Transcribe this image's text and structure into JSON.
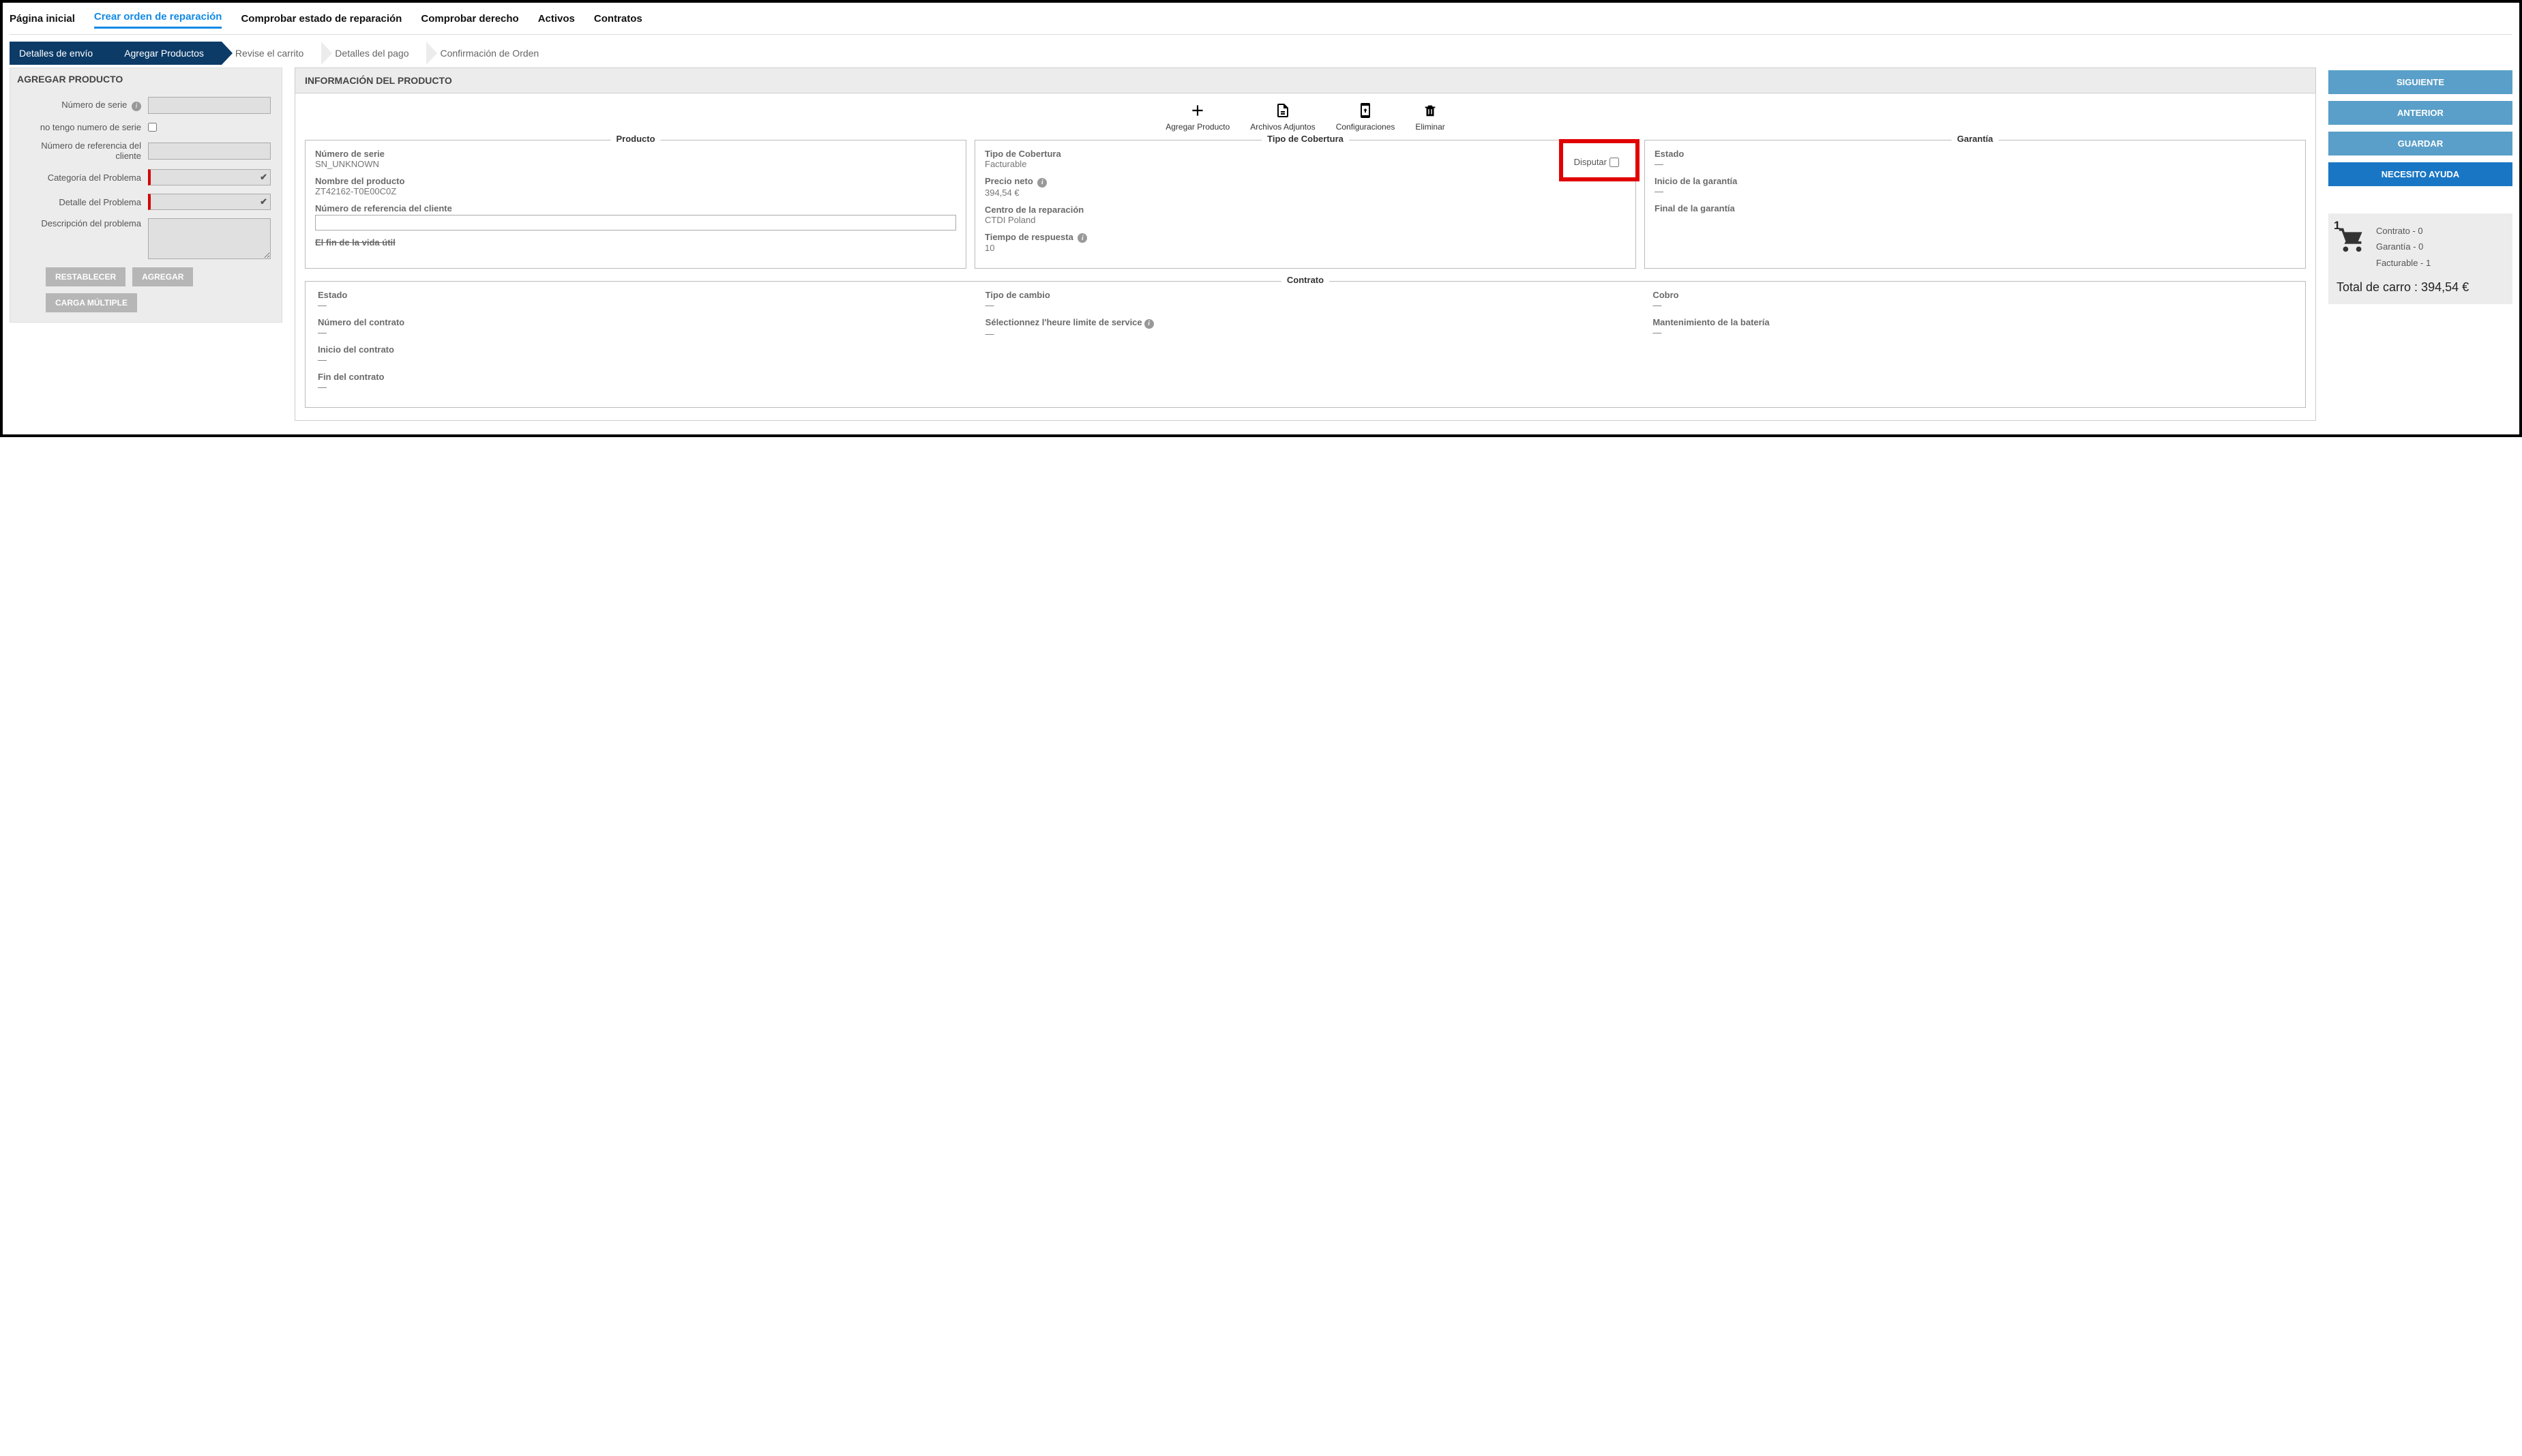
{
  "tabs": {
    "home": "Página inicial",
    "create": "Crear orden de reparación",
    "check_status": "Comprobar estado de reparación",
    "check_entitlement": "Comprobar derecho",
    "assets": "Activos",
    "contracts": "Contratos"
  },
  "steps": {
    "s1": "Detalles de envío",
    "s2": "Agregar Productos",
    "s3": "Revise el carrito",
    "s4": "Detalles del pago",
    "s5": "Confirmación de Orden"
  },
  "left": {
    "title": "AGREGAR PRODUCTO",
    "serial_label": "Número de serie",
    "no_serial_label": "no tengo numero de serie",
    "cust_ref_label": "Número de referencia del cliente",
    "problem_cat_label": "Categoría del Problema",
    "problem_detail_label": "Detalle del Problema",
    "problem_desc_label": "Descripción del problema",
    "reset": "RESTABLECER",
    "add": "AGREGAR",
    "bulk": "CARGA MÚLTIPLE"
  },
  "center": {
    "title": "INFORMACIÓN DEL PRODUCTO",
    "actions": {
      "add": "Agregar Producto",
      "attach": "Archivos Adjuntos",
      "config": "Configuraciones",
      "delete": "Eliminar"
    },
    "product": {
      "legend": "Producto",
      "serial_lbl": "Número de serie",
      "serial_val": "SN_UNKNOWN",
      "name_lbl": "Nombre del producto",
      "name_val": "ZT42162-T0E00C0Z",
      "ref_lbl": "Número de referencia del cliente",
      "eol_lbl": "El fin de la vida útil"
    },
    "coverage": {
      "legend": "Tipo de Cobertura",
      "type_lbl": "Tipo de Cobertura",
      "type_val": "Facturable",
      "dispute": "Disputar",
      "price_lbl": "Precio neto",
      "price_val": "394,54 €",
      "center_lbl": "Centro de la reparación",
      "center_val": "CTDI Poland",
      "tat_lbl": "Tiempo de respuesta",
      "tat_val": "10"
    },
    "warranty": {
      "legend": "Garantía",
      "status_lbl": "Estado",
      "status_val": "—",
      "start_lbl": "Inicio de la garantía",
      "start_val": "—",
      "end_lbl": "Final de la garantía",
      "end_val": ""
    },
    "contract": {
      "legend": "Contrato",
      "status_lbl": "Estado",
      "status_val": "—",
      "num_lbl": "Número del contrato",
      "num_val": "—",
      "start_lbl": "Inicio del contrato",
      "start_val": "—",
      "end_lbl": "Fin del contrato",
      "end_val": "—",
      "exchange_lbl": "Tipo de cambio",
      "exchange_val": "—",
      "cutoff_lbl": "Sélectionnez l'heure limite de service",
      "cutoff_val": "—",
      "charge_lbl": "Cobro",
      "charge_val": "—",
      "battery_lbl": "Mantenimiento de la batería",
      "battery_val": "—"
    }
  },
  "right": {
    "next": "SIGUIENTE",
    "prev": "ANTERIOR",
    "save": "GUARDAR",
    "help": "NECESITO AYUDA",
    "cart": {
      "count": "1",
      "line1": "Contrato - 0",
      "line2": "Garantía - 0",
      "line3": "Facturable - 1",
      "total": "Total de carro : 394,54 €"
    }
  }
}
